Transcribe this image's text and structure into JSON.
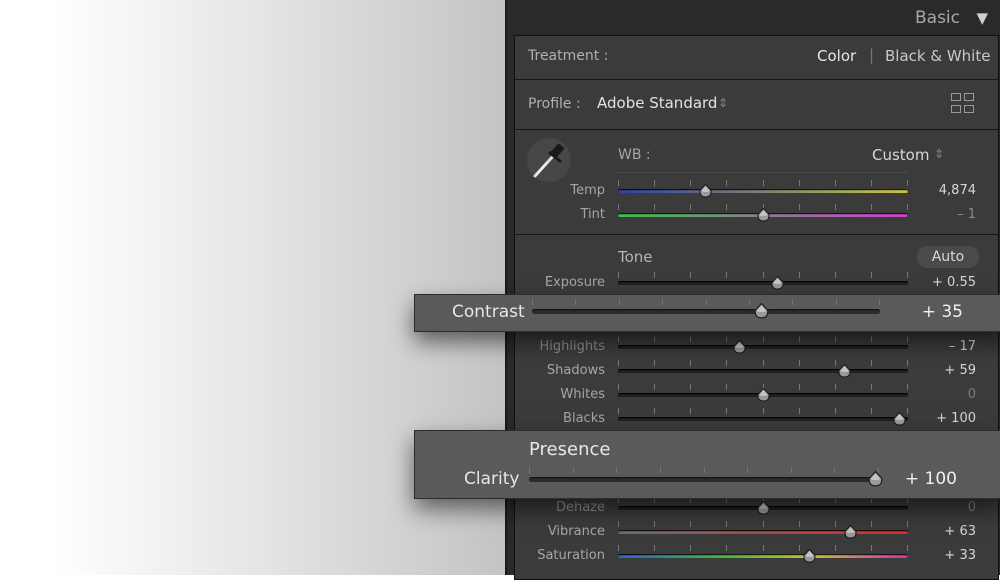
{
  "panel": {
    "title": "Basic",
    "collapse_glyph": "▼"
  },
  "treatment": {
    "label": "Treatment :",
    "color": "Color",
    "divider": "|",
    "bw": "Black & White"
  },
  "profile": {
    "label": "Profile :",
    "value": "Adobe Standard",
    "stepper": "⇕",
    "browser_icon": "grid-icon"
  },
  "wb": {
    "label": "WB :",
    "value": "Custom",
    "stepper": "⇕",
    "eyedropper_icon": "eyedropper-icon"
  },
  "tone": {
    "heading": "Tone",
    "auto_label": "Auto"
  },
  "sliders": {
    "temp": {
      "label": "Temp",
      "value": "4,874",
      "position": 0.3
    },
    "tint": {
      "label": "Tint",
      "value": "– 1",
      "position": 0.5
    },
    "exposure": {
      "label": "Exposure",
      "value": "+ 0.55",
      "position": 0.55
    },
    "highlights": {
      "label": "Highlights",
      "value": "– 17",
      "position": 0.42
    },
    "shadows": {
      "label": "Shadows",
      "value": "+ 59",
      "position": 0.78
    },
    "whites": {
      "label": "Whites",
      "value": "0",
      "position": 0.5
    },
    "blacks": {
      "label": "Blacks",
      "value": "+ 100",
      "position": 0.97
    },
    "dehaze": {
      "label": "Dehaze",
      "value": "0",
      "position": 0.5
    },
    "vibrance": {
      "label": "Vibrance",
      "value": "+ 63",
      "position": 0.8
    },
    "saturation": {
      "label": "Saturation",
      "value": "+ 33",
      "position": 0.66
    }
  },
  "contrast_overlay": {
    "label": "Contrast",
    "value": "+ 35",
    "position": 0.66
  },
  "presence_overlay": {
    "heading": "Presence",
    "label": "Clarity",
    "value": "+ 100",
    "position": 0.99
  },
  "colors": {
    "panel_bg": "#3b3b3b",
    "temp_gradient": [
      "#2f3fa8",
      "#c9c540"
    ],
    "tint_gradient": [
      "#3fbf4a",
      "#cf3fcf"
    ],
    "vibrance_gradient": [
      "#7a7a7a",
      "#d03030"
    ],
    "saturation_gradient": [
      "#3060d0",
      "#d030a0"
    ]
  }
}
